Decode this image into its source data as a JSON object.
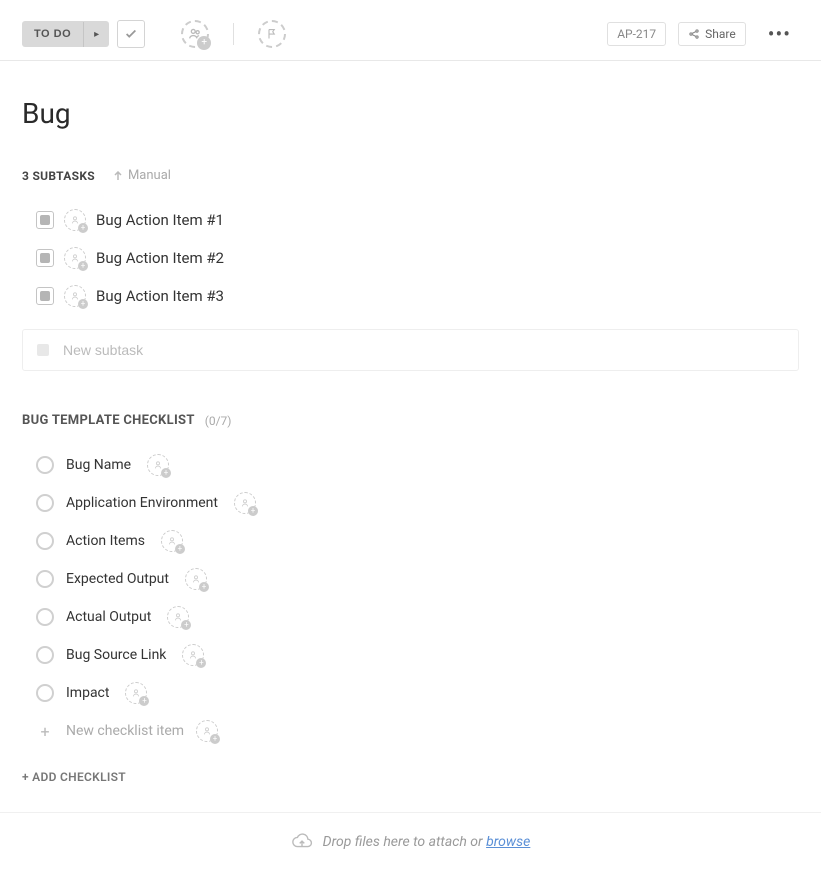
{
  "toolbar": {
    "status_label": "TO DO",
    "ticket_id": "AP-217",
    "share_label": "Share"
  },
  "title": "Bug",
  "subtasks": {
    "count_label": "3 SUBTASKS",
    "sort_label": "Manual",
    "items": [
      {
        "label": "Bug Action Item #1"
      },
      {
        "label": "Bug Action Item #2"
      },
      {
        "label": "Bug Action Item #3"
      }
    ],
    "new_placeholder": "New subtask"
  },
  "checklist": {
    "title": "BUG TEMPLATE CHECKLIST",
    "progress": "(0/7)",
    "items": [
      {
        "label": "Bug Name"
      },
      {
        "label": "Application Environment"
      },
      {
        "label": "Action Items"
      },
      {
        "label": "Expected Output"
      },
      {
        "label": "Actual Output"
      },
      {
        "label": "Bug Source Link"
      },
      {
        "label": "Impact"
      }
    ],
    "new_placeholder": "New checklist item",
    "add_label": "+ ADD CHECKLIST"
  },
  "attach": {
    "text_prefix": "Drop files here to attach or ",
    "browse_label": "browse"
  }
}
